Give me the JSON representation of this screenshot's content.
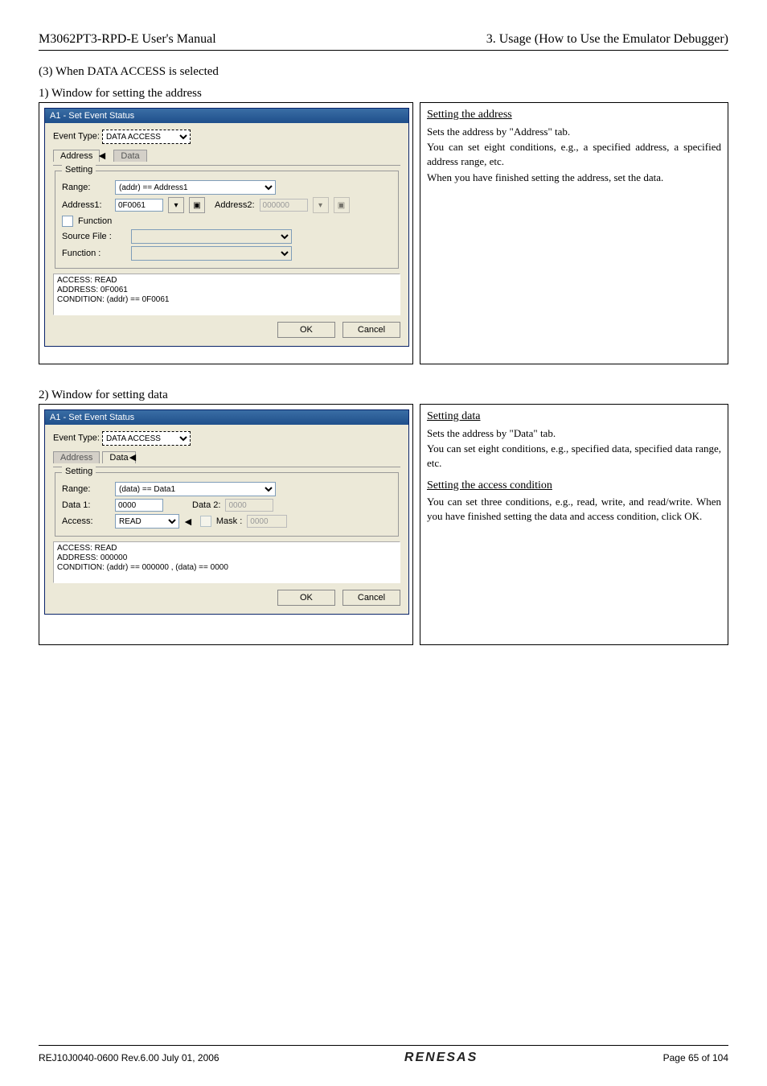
{
  "header": {
    "left": "M3062PT3-RPD-E User's Manual",
    "right": "3. Usage (How to Use the Emulator Debugger)"
  },
  "section": {
    "title": "(3) When DATA ACCESS is selected"
  },
  "part1": {
    "caption": "1) Window for setting the address",
    "win_title": "A1 - Set Event Status",
    "ev_label": "Event Type:",
    "ev_value": "DATA ACCESS",
    "tab1": "Address",
    "tab2": "Data",
    "grp": "Setting",
    "range_label": "Range:",
    "range_value": "(addr) == Address1",
    "addr1_label": "Address1:",
    "addr1_value": "0F0061",
    "addr2_label": "Address2:",
    "addr2_value": "000000",
    "func_chk": "Function",
    "src_label": "Source File :",
    "func_label": "Function :",
    "status": "ACCESS: READ\nADDRESS: 0F0061\nCONDITION: (addr) == 0F0061",
    "ok": "OK",
    "cancel": "Cancel",
    "desc_h": "Setting the address",
    "desc_l1": "Sets the address by \"Address\" tab.",
    "desc_l2": "You can set eight conditions, e.g., a specified address, a specified address range, etc.",
    "desc_l3": "When you have finished setting the address, set the data."
  },
  "part2": {
    "caption": "2) Window for setting data",
    "win_title": "A1 - Set Event Status",
    "ev_label": "Event Type:",
    "ev_value": "DATA ACCESS",
    "tab1": "Address",
    "tab2": "Data",
    "grp": "Setting",
    "range_label": "Range:",
    "range_value": "(data) == Data1",
    "d1_label": "Data 1:",
    "d1_value": "0000",
    "d2_label": "Data 2:",
    "d2_value": "0000",
    "acc_label": "Access:",
    "acc_value": "READ",
    "mask_label": "Mask :",
    "mask_value": "0000",
    "status": "ACCESS: READ\nADDRESS: 000000\nCONDITION: (addr) == 000000 , (data) == 0000",
    "ok": "OK",
    "cancel": "Cancel",
    "desc_h1": "Setting data",
    "desc_l1": "Sets the address by \"Data\" tab.",
    "desc_l2": "You can set eight conditions, e.g., specified data, specified data range, etc.",
    "desc_h2": "Setting the access condition",
    "desc_l3": "You can set three conditions, e.g., read, write, and read/write. When you have finished setting the data and access condition, click OK."
  },
  "footer": {
    "left": "REJ10J0040-0600  Rev.6.00  July  01,  2006",
    "logo": "RENESAS",
    "right": "Page  65  of  104"
  }
}
